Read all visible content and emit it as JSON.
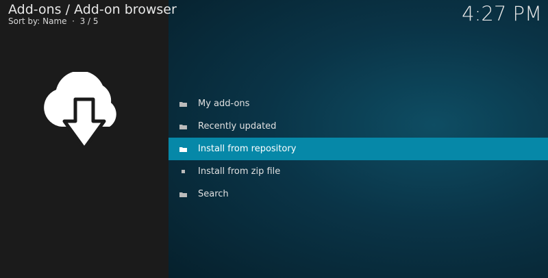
{
  "header": {
    "title": "Add-ons / Add-on browser",
    "sort_label": "Sort by: Name",
    "position": "3 / 5",
    "clock": "4:27 PM"
  },
  "colors": {
    "selected": "#0688a8",
    "left_panel": "#1b1b1b"
  },
  "preview": {
    "icon": "cloud-download-icon"
  },
  "menu": {
    "items": [
      {
        "label": "My add-ons",
        "icon": "folder-icon"
      },
      {
        "label": "Recently updated",
        "icon": "folder-icon"
      },
      {
        "label": "Install from repository",
        "icon": "folder-open-icon",
        "selected": true
      },
      {
        "label": "Install from zip file",
        "icon": "file-icon"
      },
      {
        "label": "Search",
        "icon": "folder-icon"
      }
    ]
  }
}
